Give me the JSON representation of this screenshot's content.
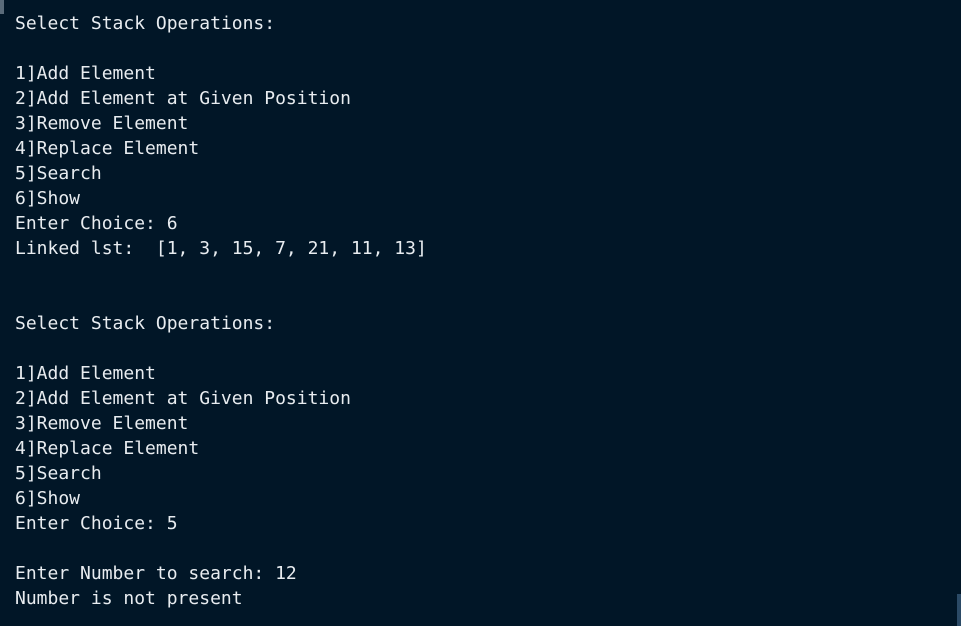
{
  "terminal": {
    "lines": [
      "Select Stack Operations:",
      "",
      "1]Add Element",
      "2]Add Element at Given Position",
      "3]Remove Element",
      "4]Replace Element",
      "5]Search",
      "6]Show",
      "Enter Choice: 6",
      "Linked lst:  [1, 3, 15, 7, 21, 11, 13]",
      "",
      "",
      "Select Stack Operations:",
      "",
      "1]Add Element",
      "2]Add Element at Given Position",
      "3]Remove Element",
      "4]Replace Element",
      "5]Search",
      "6]Show",
      "Enter Choice: 5",
      "",
      "Enter Number to search: 12",
      "Number is not present"
    ]
  },
  "colors": {
    "background": "#011627",
    "foreground": "#e8ecf0"
  }
}
